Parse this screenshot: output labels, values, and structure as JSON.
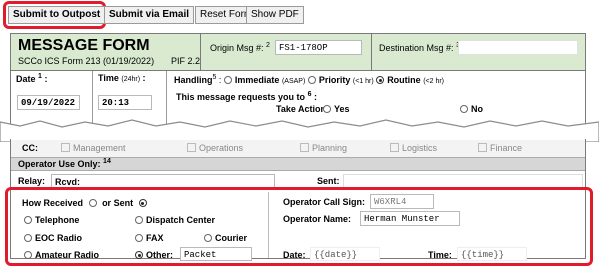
{
  "toolbar": {
    "submit_outpost": "Submit to Outpost",
    "submit_email": "Submit via Email",
    "reset": "Reset Form",
    "show_pdf": "Show PDF"
  },
  "header": {
    "title": "MESSAGE FORM",
    "subtitle": "SCCo ICS Form 213 (01/19/2022)",
    "pif": "PIF 2.2",
    "origin_label": "Origin Msg #:",
    "origin_sup": "2",
    "origin_value": "FS1-178OP",
    "dest_label": "Destination Msg #:",
    "dest_sup": "3"
  },
  "row1": {
    "date_label": "Date",
    "date_sup": "1",
    "date_value": "09/19/2022",
    "time_label": "Time",
    "time_hint": "(24hr)",
    "time_value": "20:13",
    "handling_label": "Handling",
    "handling_sup": "5",
    "immediate": "Immediate",
    "immediate_hint": "(ASAP)",
    "priority": "Priority",
    "priority_hint": "(<1 hr)",
    "routine": "Routine",
    "routine_hint": "(<2 hr)",
    "requests_label": "This message requests you to",
    "requests_sup": "6",
    "take_action": "Take Action:",
    "yes": "Yes",
    "no": "No"
  },
  "cc": {
    "label": "CC:",
    "options": [
      "Management",
      "Operations",
      "Planning",
      "Logistics",
      "Finance"
    ]
  },
  "operator": {
    "use_only": "Operator Use Only:",
    "use_only_sup": "14",
    "relay_label": "Relay:",
    "rcvd_label": "Rcvd:",
    "sent_label": "Sent:",
    "how_received": "How Received",
    "or_sent": "or Sent",
    "methods": {
      "telephone": "Telephone",
      "dispatch": "Dispatch Center",
      "eoc": "EOC Radio",
      "fax": "FAX",
      "courier": "Courier",
      "amateur": "Amateur Radio",
      "other": "Other:",
      "other_value": "Packet"
    },
    "call_sign_label": "Operator Call Sign:",
    "call_sign_value": "W6XRL4",
    "name_label": "Operator Name:",
    "name_value": "Herman Munster",
    "date_label": "Date:",
    "date_value": "{{date}}",
    "time_label": "Time:",
    "time_value": "{{time}}"
  },
  "colors": {
    "highlight": "#e21b2c",
    "section_bg": "#d9ead0"
  }
}
